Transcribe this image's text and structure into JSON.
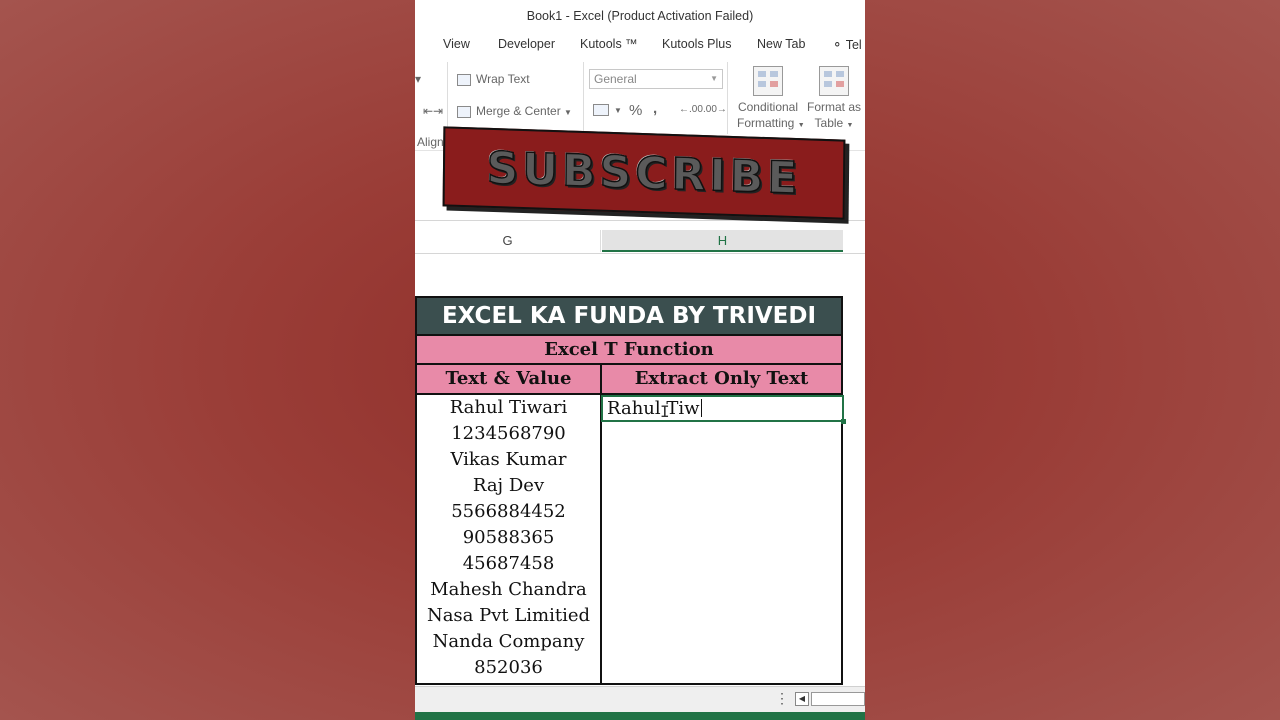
{
  "window": {
    "title": "Book1 - Excel (Product Activation Failed)"
  },
  "ribbon_tabs": [
    "View",
    "Developer",
    "Kutools ™",
    "Kutools Plus",
    "New Tab",
    "Tel"
  ],
  "ribbon": {
    "wrap_text": "Wrap Text",
    "merge_center": "Merge & Center",
    "number_format": "General",
    "percent": "%",
    "comma": ",",
    "increase_decimal": ".00",
    "decrease_decimal": ".00",
    "conditional_formatting_line1": "Conditional",
    "conditional_formatting_line2": "Formatting",
    "format_as_table_line1": "Format as",
    "format_as_table_line2": "Table",
    "alignment_group_label": "Align"
  },
  "overlay": {
    "subscribe": "SUBSCRIBE"
  },
  "columns": {
    "g": "G",
    "h": "H"
  },
  "sheet": {
    "banner": "EXCEL KA FUNDA BY TRIVEDI",
    "subtitle": "Excel T Function",
    "header_a": "Text & Value",
    "header_b": "Extract Only Text",
    "values": [
      "Rahul Tiwari",
      "1234568790",
      "Vikas Kumar",
      "Raj Dev",
      "5566884452",
      "90588365",
      "45687458",
      "Mahesh Chandra",
      "Nasa Pvt Limitied",
      "Nanda Company",
      "852036"
    ],
    "editing_cell_text": "Rahul Tiw"
  },
  "colors": {
    "accent": "#217346",
    "banner": "#3b4f4f",
    "header_pink": "#e88aa8",
    "subscribe_bg": "#8a1c1c"
  }
}
